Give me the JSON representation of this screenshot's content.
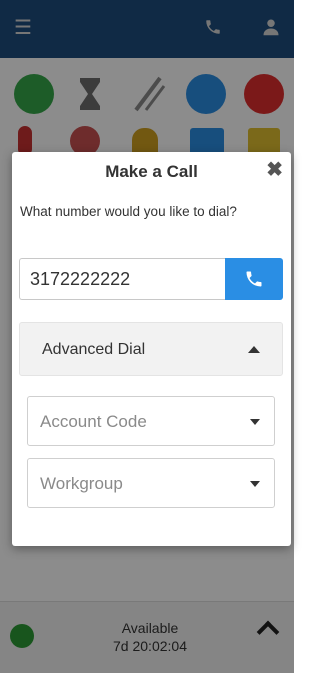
{
  "topbar": {
    "menu_icon": "hamburger-icon",
    "phone_icon": "phone-icon",
    "user_icon": "user-icon"
  },
  "status_icons": [
    "check-circle-icon",
    "hourglass-icon",
    "no-call-icon",
    "arrow-right-circle-icon",
    "x-circle-icon"
  ],
  "colors": {
    "topbar": "#1e4e7e",
    "accent": "#2a8ee4",
    "available": "#2d9c35",
    "busy": "#e02e2e"
  },
  "modal": {
    "title": "Make a Call",
    "close_icon": "close-icon",
    "prompt": "What number would you like to dial?",
    "number_value": "3172222222",
    "dial_button_icon": "phone-icon",
    "advanced_label": "Advanced Dial",
    "advanced_icon": "caret-up-icon",
    "account_code_label": "Account Code",
    "workgroup_label": "Workgroup"
  },
  "footer": {
    "status": "Available",
    "time": "7d 20:02:04"
  }
}
